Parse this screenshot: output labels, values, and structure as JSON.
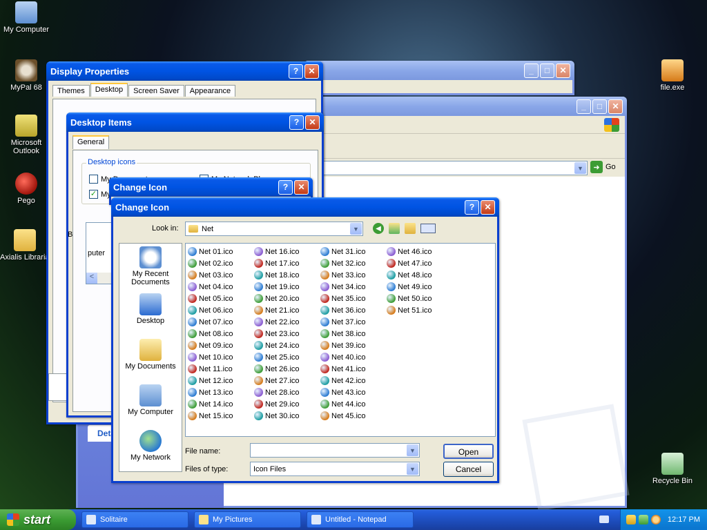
{
  "desktop": {
    "icons": [
      {
        "label": "My Computer",
        "color": "#7aa6de"
      },
      {
        "label": "MyPal 68",
        "color": "#6b4f2a"
      },
      {
        "label": "Microsoft Outlook",
        "color": "#d4c23a"
      },
      {
        "label": "Pego",
        "color": "#c0231a"
      },
      {
        "label": "Axialis Librarian",
        "color": "#e8c75a"
      },
      {
        "label": "file.exe",
        "color": "#e89a2a"
      },
      {
        "label": "Recycle Bin",
        "color": "#5fb55f"
      }
    ]
  },
  "display_properties": {
    "title": "Display Properties",
    "help": "?",
    "close": "✕",
    "tabs": [
      "Themes",
      "Desktop",
      "Screen Saver",
      "Appearance"
    ]
  },
  "desktop_items": {
    "title": "Desktop Items",
    "help": "?",
    "close": "✕",
    "tab": "General",
    "group_label": "Desktop icons",
    "checkboxes": [
      {
        "label": "My Documents",
        "checked": false
      },
      {
        "label": "My Network Places",
        "checked": false
      },
      {
        "label": "My",
        "checked": true
      }
    ],
    "side_letters": [
      "B",
      "E"
    ],
    "fragments": [
      "puter",
      "M"
    ],
    "scroll_left": "<"
  },
  "back_window": {
    "minimize": "_",
    "maximize": "□",
    "close": "✕"
  },
  "explorer": {
    "minimize": "_",
    "maximize": "□",
    "close": "✕",
    "go_label": "Go",
    "details_label": "Deta"
  },
  "change_icon_back": {
    "title": "Change Icon",
    "help": "?",
    "close": "✕"
  },
  "change_icon": {
    "title": "Change Icon",
    "help": "?",
    "close": "✕",
    "look_in_label": "Look in:",
    "look_in_value": "Net",
    "places": [
      "My Recent Documents",
      "Desktop",
      "My Documents",
      "My Computer",
      "My Network"
    ],
    "files": [
      "Net 01.ico",
      "Net 02.ico",
      "Net 03.ico",
      "Net 04.ico",
      "Net 05.ico",
      "Net 06.ico",
      "Net 07.ico",
      "Net 08.ico",
      "Net 09.ico",
      "Net 10.ico",
      "Net 11.ico",
      "Net 12.ico",
      "Net 13.ico",
      "Net 14.ico",
      "Net 15.ico",
      "Net 16.ico",
      "Net 17.ico",
      "Net 18.ico",
      "Net 19.ico",
      "Net 20.ico",
      "Net 21.ico",
      "Net 22.ico",
      "Net 23.ico",
      "Net 24.ico",
      "Net 25.ico",
      "Net 26.ico",
      "Net 27.ico",
      "Net 28.ico",
      "Net 29.ico",
      "Net 30.ico",
      "Net 31.ico",
      "Net 32.ico",
      "Net 33.ico",
      "Net 34.ico",
      "Net 35.ico",
      "Net 36.ico",
      "Net 37.ico",
      "Net 38.ico",
      "Net 39.ico",
      "Net 40.ico",
      "Net 41.ico",
      "Net 42.ico",
      "Net 43.ico",
      "Net 44.ico",
      "Net 45.ico",
      "Net 46.ico",
      "Net 47.ico",
      "Net 48.ico",
      "Net 49.ico",
      "Net 50.ico",
      "Net 51.ico"
    ],
    "file_name_label": "File name:",
    "file_name_value": "",
    "file_type_label": "Files of type:",
    "file_type_value": "Icon Files",
    "open_label": "Open",
    "cancel_label": "Cancel"
  },
  "taskbar": {
    "start_label": "start",
    "tasks": [
      "Solitaire",
      "My Pictures",
      "Untitled - Notepad"
    ],
    "clock": "12:17 PM"
  }
}
